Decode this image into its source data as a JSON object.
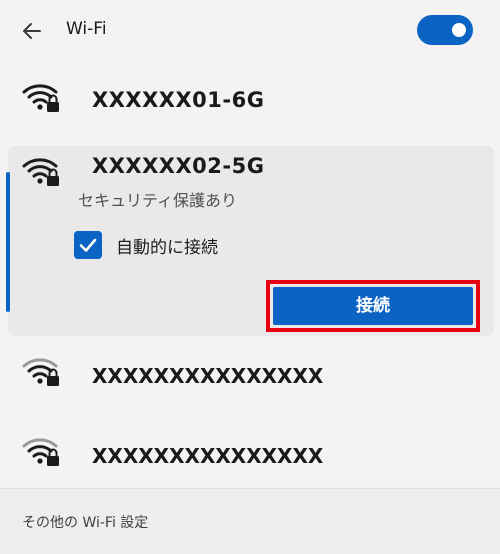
{
  "header": {
    "title": "Wi-Fi",
    "wifi_enabled": true,
    "accent_color": "#0b64c4"
  },
  "networks": [
    {
      "name": "XXXXXX01-6G",
      "icon": "wifi-secured-icon"
    },
    {
      "name": "XXXXXX02-5G",
      "icon": "wifi-secured-icon",
      "status": "セキュリティ保護あり",
      "auto_connect_label": "自動的に接続",
      "auto_connect_checked": true,
      "connect_label": "接続"
    },
    {
      "name": "XXXXXXXXXXXXXXX",
      "icon": "wifi-secured-icon"
    },
    {
      "name": "XXXXXXXXXXXXXXX",
      "icon": "wifi-secured-icon"
    }
  ],
  "footer": {
    "link_label": "その他の Wi-Fi 設定"
  },
  "highlight_color": "#e60012"
}
